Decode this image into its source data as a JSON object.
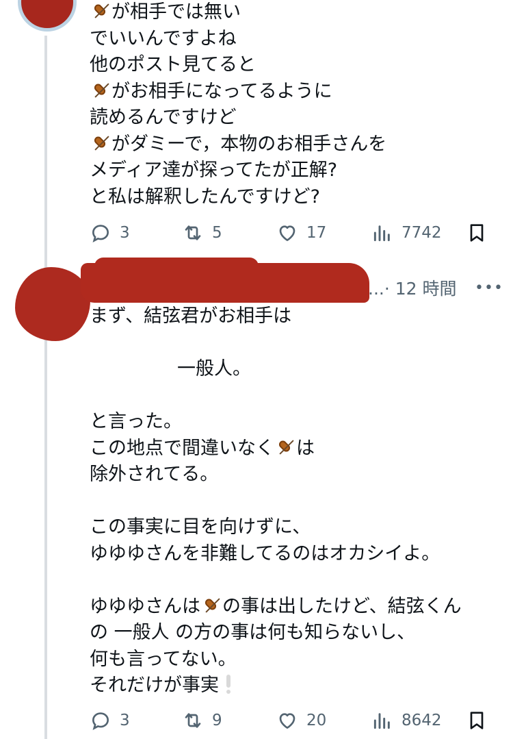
{
  "post1": {
    "lines": [
      {
        "icon": "violin-icon",
        "text": "が相手では無い"
      },
      {
        "text": "でいいんですよね"
      },
      {
        "text": "他のポスト見てると"
      },
      {
        "icon": "violin-icon",
        "text": "がお相手になってるように"
      },
      {
        "text": "読めるんですけど"
      },
      {
        "icon": "violin-icon",
        "text": "がダミーで，本物のお相手さんを"
      },
      {
        "text": "メディア達が探ってたが正解?"
      },
      {
        "text": "と私は解釈したんですけど?"
      }
    ],
    "actions": {
      "replies": "3",
      "reposts": "5",
      "likes": "17",
      "views": "7742"
    }
  },
  "post2": {
    "meta": "...· 12 時間",
    "more": "•••",
    "lines": [
      "まず、結弦君がお相手は",
      "",
      "一般人。",
      "",
      "と言った。",
      "この地点で間違いなく",
      "は",
      "除外されてる。",
      "",
      "この事実に目を向けずに、",
      "ゆゆゆさんを非難してるのはオカシイよ。",
      "",
      "ゆゆゆさんは",
      "の事は出したけど、結弦くん",
      "の 一般人 の方の事は何も知らないし、",
      "何も言ってない。",
      "それだけが事実"
    ],
    "actions": {
      "replies": "3",
      "reposts": "9",
      "likes": "20",
      "views": "8642"
    }
  },
  "icons": {
    "reply": "reply-icon",
    "repost": "repost-icon",
    "like": "heart-icon",
    "views": "views-icon",
    "bookmark": "bookmark-icon",
    "violin": "violin-icon",
    "exclamation": "exclamation-icon"
  },
  "colors": {
    "text": "#0f1419",
    "muted": "#536471",
    "thread_line": "#d9dde1",
    "redaction": "#b02a1e"
  }
}
